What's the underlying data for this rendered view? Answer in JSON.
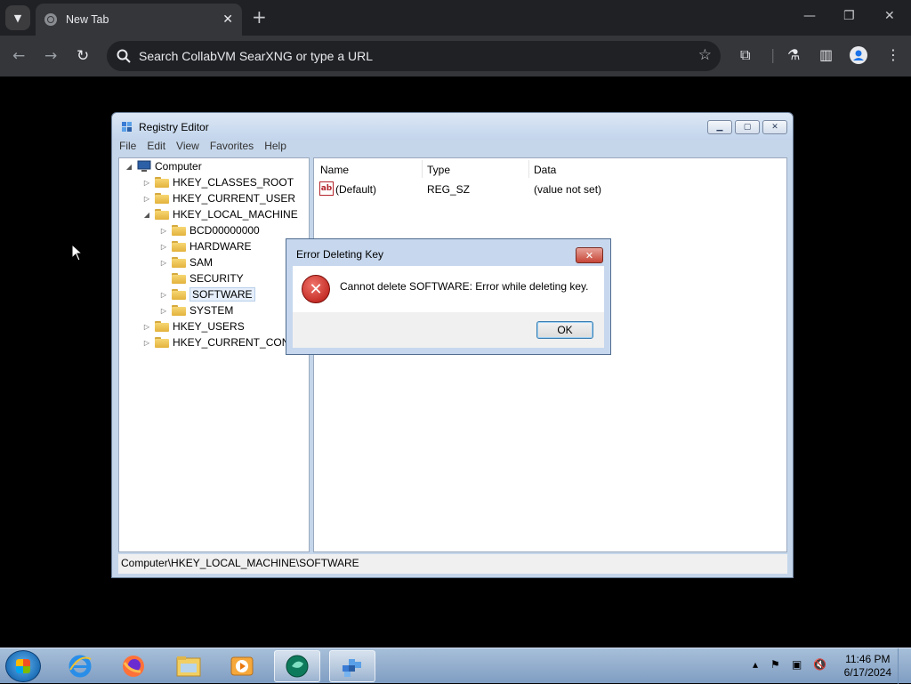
{
  "browser": {
    "tab_title": "New Tab",
    "new_tab_glyph": "+",
    "address_placeholder": "Search CollabVM SearXNG or type a URL"
  },
  "regedit": {
    "title": "Registry Editor",
    "menu": [
      "File",
      "Edit",
      "View",
      "Favorites",
      "Help"
    ],
    "tree": {
      "root": "Computer",
      "hives": [
        {
          "label": "HKEY_CLASSES_ROOT"
        },
        {
          "label": "HKEY_CURRENT_USER"
        },
        {
          "label": "HKEY_LOCAL_MACHINE",
          "children": [
            "BCD00000000",
            "HARDWARE",
            "SAM",
            "SECURITY",
            "SOFTWARE",
            "SYSTEM"
          ]
        },
        {
          "label": "HKEY_USERS"
        },
        {
          "label": "HKEY_CURRENT_CONF"
        }
      ],
      "selected": "SOFTWARE"
    },
    "columns": [
      "Name",
      "Type",
      "Data"
    ],
    "rows": [
      {
        "name": "(Default)",
        "type": "REG_SZ",
        "data": "(value not set)"
      }
    ],
    "status_path": "Computer\\HKEY_LOCAL_MACHINE\\SOFTWARE"
  },
  "dialog": {
    "title": "Error Deleting Key",
    "message": "Cannot delete SOFTWARE:  Error while deleting key.",
    "ok_label": "OK"
  },
  "taskbar": {
    "time": "11:46 PM",
    "date": "6/17/2024"
  },
  "icons": {
    "error": "error-icon",
    "folder": "folder-icon",
    "computer": "computer-icon",
    "string_value": "string-value-icon"
  },
  "colors": {
    "titlebar": "#c7d8ee",
    "error_red": "#b4140e",
    "folder_yellow": "#f7d774",
    "taskbar": "#a7bfd9"
  }
}
